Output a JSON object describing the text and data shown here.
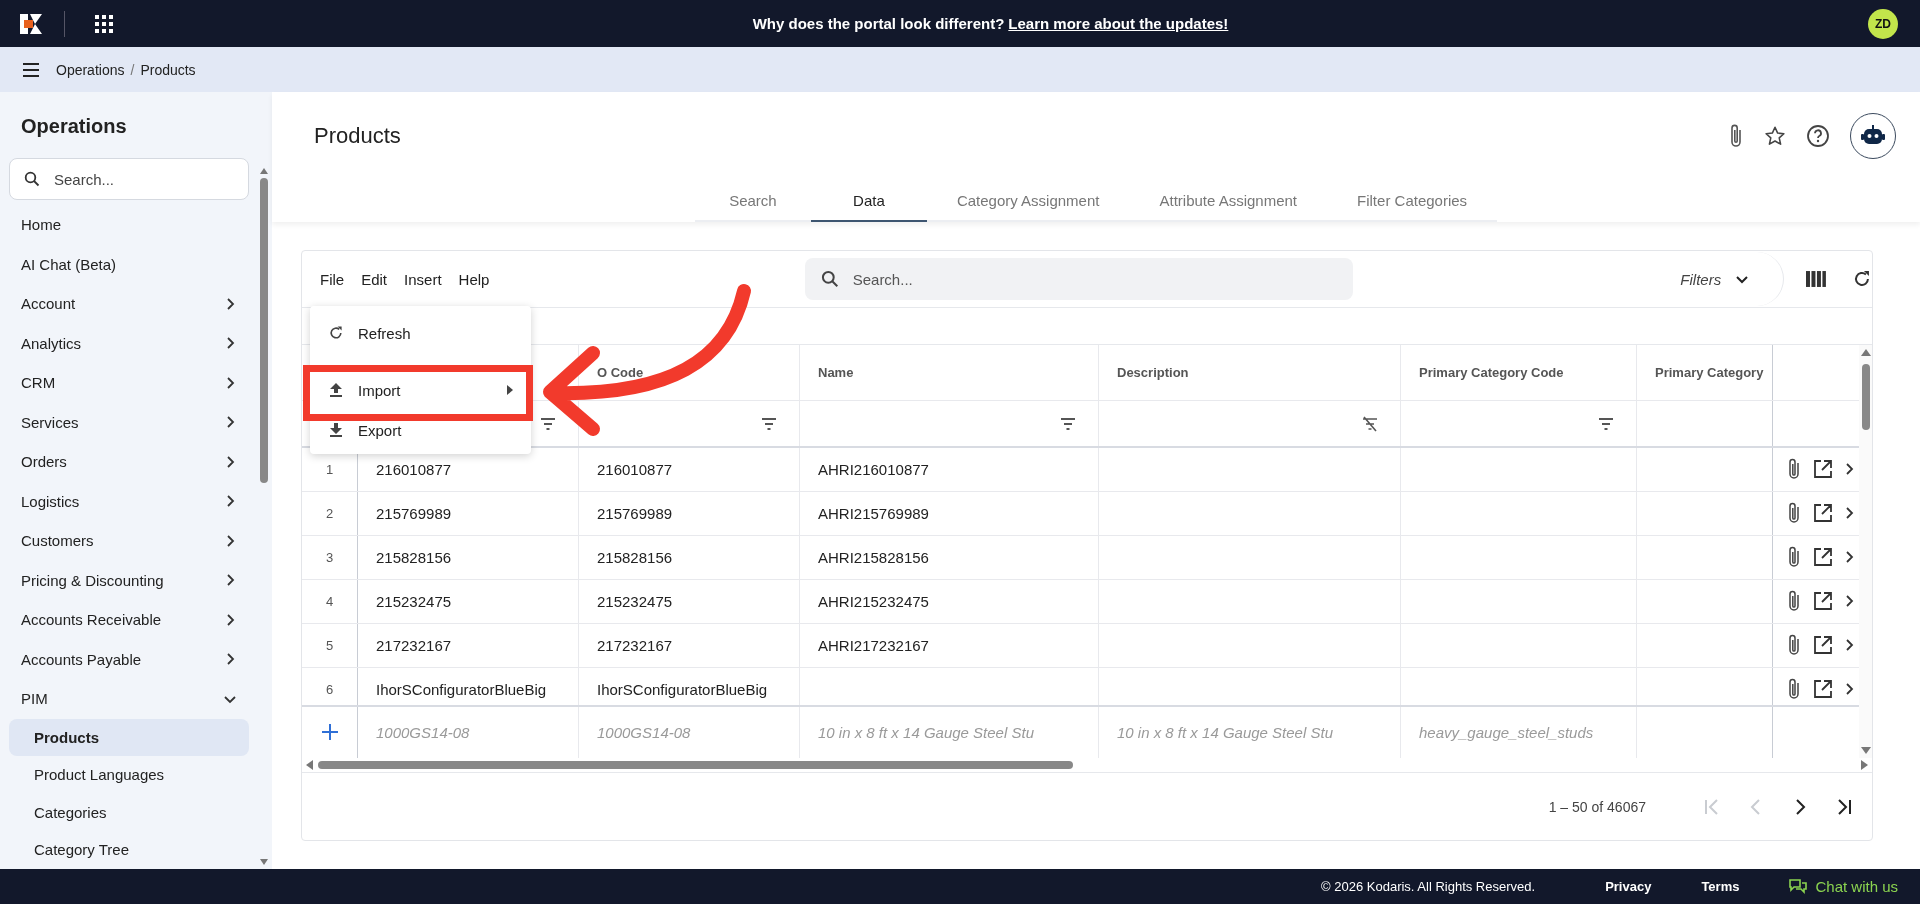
{
  "top_bar": {
    "announcement": "Why does the portal look different?",
    "link": "Learn more about the updates!",
    "avatar": "ZD"
  },
  "breadcrumb": {
    "items": [
      "Operations",
      "Products"
    ],
    "separator": "/"
  },
  "sidebar": {
    "title": "Operations",
    "search": {
      "placeholder": "Search..."
    },
    "items": [
      {
        "label": "Home",
        "kind": "link",
        "selected": false
      },
      {
        "label": "AI Chat (Beta)",
        "kind": "link",
        "selected": false
      },
      {
        "label": "Account",
        "kind": "group",
        "expanded": false
      },
      {
        "label": "Analytics",
        "kind": "group",
        "expanded": false
      },
      {
        "label": "CRM",
        "kind": "group",
        "expanded": false
      },
      {
        "label": "Services",
        "kind": "group",
        "expanded": false
      },
      {
        "label": "Orders",
        "kind": "group",
        "expanded": false
      },
      {
        "label": "Logistics",
        "kind": "group",
        "expanded": false
      },
      {
        "label": "Customers",
        "kind": "group",
        "expanded": false
      },
      {
        "label": "Pricing & Discounting",
        "kind": "group",
        "expanded": false
      },
      {
        "label": "Accounts Receivable",
        "kind": "group",
        "expanded": false
      },
      {
        "label": "Accounts Payable",
        "kind": "group",
        "expanded": false
      },
      {
        "label": "PIM",
        "kind": "group",
        "expanded": true,
        "children": [
          {
            "label": "Products",
            "selected": true
          },
          {
            "label": "Product Languages",
            "selected": false
          },
          {
            "label": "Categories",
            "selected": false
          },
          {
            "label": "Category Tree",
            "selected": false
          }
        ]
      }
    ]
  },
  "page": {
    "title": "Products",
    "tabs": [
      {
        "label": "Search",
        "selected": false
      },
      {
        "label": "Data",
        "selected": true
      },
      {
        "label": "Category Assignment",
        "selected": false
      },
      {
        "label": "Attribute Assignment",
        "selected": false
      },
      {
        "label": "Filter Categories",
        "selected": false
      }
    ]
  },
  "grid": {
    "menus": [
      "File",
      "Edit",
      "Insert",
      "Help"
    ],
    "file_menu": [
      {
        "label": "Refresh",
        "submenu": false
      },
      {
        "label": "Import",
        "submenu": true
      },
      {
        "label": "Export",
        "submenu": false
      }
    ],
    "search": {
      "placeholder": "Search..."
    },
    "filters": "Filters",
    "columns": [
      {
        "filterable": true,
        "filter_cleared": false
      },
      {
        "label": "O Code",
        "filterable": true,
        "filter_cleared": false
      },
      {
        "label": "Name",
        "filterable": true,
        "filter_cleared": false
      },
      {
        "label": "Description",
        "filterable": true,
        "filter_cleared": true
      },
      {
        "label": "Primary Category Code",
        "filterable": true,
        "filter_cleared": false
      },
      {
        "label": "Primary Category"
      }
    ],
    "rows": [
      {
        "number": "1",
        "cells": [
          "216010877",
          "216010877",
          "AHRI216010877"
        ]
      },
      {
        "number": "2",
        "cells": [
          "215769989",
          "215769989",
          "AHRI215769989"
        ]
      },
      {
        "number": "3",
        "cells": [
          "215828156",
          "215828156",
          "AHRI215828156"
        ]
      },
      {
        "number": "4",
        "cells": [
          "215232475",
          "215232475",
          "AHRI215232475"
        ]
      },
      {
        "number": "5",
        "cells": [
          "217232167",
          "217232167",
          "AHRI217232167"
        ]
      },
      {
        "number": "6",
        "cells": [
          "IhorSConfiguratorBlueBig",
          "IhorSConfiguratorBlueBig"
        ]
      }
    ],
    "new_row": {
      "placeholders": [
        "1000GS14-08",
        "1000GS14-08",
        "10 in x 8 ft x 14 Gauge Steel Stu",
        "10 in x 8 ft x 14 Gauge Steel Stu",
        "heavy_gauge_steel_studs"
      ]
    },
    "pager": {
      "range": "1 – 50 of 46067",
      "buttons": [
        {
          "disabled": true
        },
        {
          "disabled": true
        },
        {
          "disabled": false
        },
        {
          "disabled": false
        }
      ]
    }
  },
  "footer": {
    "copyright": "© 2026 Kodaris. All Rights Reserved.",
    "links": [
      "Privacy",
      "Terms"
    ],
    "chat": "Chat with us"
  }
}
